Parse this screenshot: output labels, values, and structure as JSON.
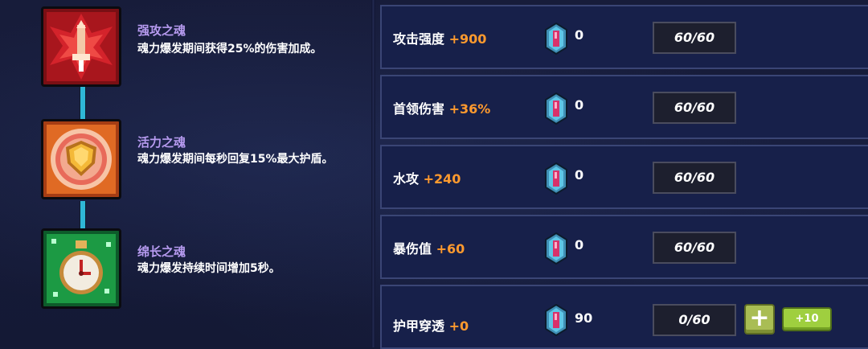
{
  "souls": [
    {
      "name": "强攻之魂",
      "description": "魂力爆发期间获得25%的伤害加成。",
      "icon": "strike-soul-icon",
      "color": "#c9252b"
    },
    {
      "name": "活力之魂",
      "description": "魂力爆发期间每秒回复15%最大护盾。",
      "icon": "vitality-soul-icon",
      "color": "#e8742a"
    },
    {
      "name": "绵长之魂",
      "description": "魂力爆发持续时间增加5秒。",
      "icon": "longevity-soul-icon",
      "color": "#1fa64a"
    }
  ],
  "stats": [
    {
      "label": "攻击强度",
      "value": "+900",
      "gem_count": "0",
      "progress": "60/60"
    },
    {
      "label": "首领伤害",
      "value": "+36%",
      "gem_count": "0",
      "progress": "60/60"
    },
    {
      "label": "水攻",
      "value": "+240",
      "gem_count": "0",
      "progress": "60/60"
    },
    {
      "label": "暴伤值",
      "value": "+60",
      "gem_count": "0",
      "progress": "60/60"
    },
    {
      "label": "护甲穿透",
      "value": "+0",
      "gem_count": "90",
      "progress": "0/60",
      "plus_label": "+",
      "add10_label": "+10"
    }
  ],
  "colors": {
    "accent_value": "#ff9a2e",
    "soul_name": "#b79bf0",
    "connector": "#2fb7d6"
  }
}
